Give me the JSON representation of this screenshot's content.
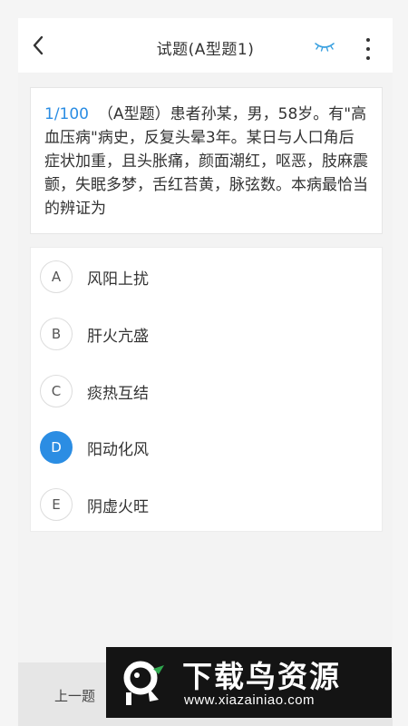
{
  "header": {
    "title": "试题(A型题1)",
    "back_icon": "chevron-left-icon",
    "eye_icon": "closed-eye-icon",
    "more_icon": "more-vertical-icon"
  },
  "question": {
    "number": "1/100",
    "text": "（A型题）患者孙某，男，58岁。有\"高血压病\"病史，反复头晕3年。某日与人口角后症状加重，且头胀痛，颜面潮红，呕恶，肢麻震颤，失眠多梦，舌红苔黄，脉弦数。本病最恰当的辨证为"
  },
  "options": [
    {
      "letter": "A",
      "text": "风阳上扰",
      "selected": false
    },
    {
      "letter": "B",
      "text": "肝火亢盛",
      "selected": false
    },
    {
      "letter": "C",
      "text": "痰热互结",
      "selected": false
    },
    {
      "letter": "D",
      "text": "阳动化风",
      "selected": true
    },
    {
      "letter": "E",
      "text": "阴虚火旺",
      "selected": false
    }
  ],
  "footer": {
    "prev_label": "上一题"
  },
  "watermark": {
    "title": "下载鸟资源",
    "url": "www.xiazainiao.com"
  },
  "colors": {
    "accent": "#2b8de3",
    "background": "#f3f3f3",
    "card": "#ffffff",
    "text": "#333333",
    "watermark_bg": "#141414"
  }
}
